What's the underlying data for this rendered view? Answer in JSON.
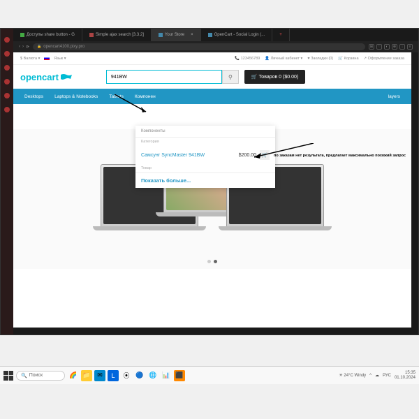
{
  "browser": {
    "tabs": [
      {
        "label": "Доступы share button - G"
      },
      {
        "label": "Simple ajax search [3.3.2]"
      },
      {
        "label": "Your Store",
        "active": true
      },
      {
        "label": "OpenCart - Social Login (..."
      }
    ],
    "url": "opencart4100.pixy.pro"
  },
  "topbar": {
    "currency": "$ Валюта ▾",
    "language": "Язык ▾",
    "phone": "📞 123456789",
    "account": "👤 Личный кабинет ▾",
    "wishlist": "♥ Закладки (0)",
    "cart": "🛒 Корзина",
    "checkout": "↗ Оформление заказа"
  },
  "header": {
    "logo": "opencart",
    "search_value": "941BW",
    "cart": "🛒 Товаров 0 ($0.00)"
  },
  "nav": [
    "Desktops",
    "Laptops & Notebooks",
    "Tablets",
    "Компонен",
    "layers"
  ],
  "dropdown": {
    "title": "Компоненты",
    "category": "Категория",
    "item_name": "Самсунг SyncMaster 941BW",
    "item_price": "$200.00",
    "type": "Товар",
    "more": "Показать больше..."
  },
  "annotation": "по заказам нет результата, предлагает максимально похожий запрос",
  "taskbar": {
    "search": "Поиск",
    "weather": "24°C Windy",
    "lang": "РУС",
    "time": "15:35",
    "date": "01.10.2024"
  }
}
